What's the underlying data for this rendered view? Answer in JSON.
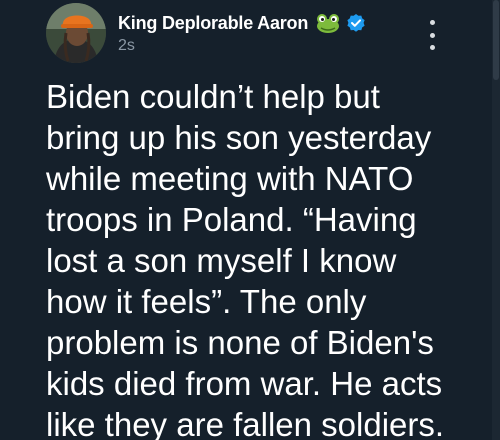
{
  "post": {
    "author": {
      "display_name": "King Deplorable Aaron",
      "avatar_icon": "user-avatar-photo",
      "badge_icon": "frog-emoji-icon",
      "verified_icon": "verified-check-icon",
      "verified_color": "#1d9bf0"
    },
    "timestamp": "2s",
    "menu_icon": "vertical-ellipsis-icon",
    "body_lines": [
      "Biden couldn’t help but",
      "bring up his son yesterday",
      "while meeting with NATO",
      "troops in Poland. “Having",
      "lost a son myself I know",
      "how it feels”. The only",
      "problem is none of Biden's",
      "kids died from war. He acts",
      "like they are fallen soldiers."
    ]
  },
  "theme": {
    "background": "#15202b",
    "text": "#ffffff",
    "muted_text": "#8b98a5"
  }
}
